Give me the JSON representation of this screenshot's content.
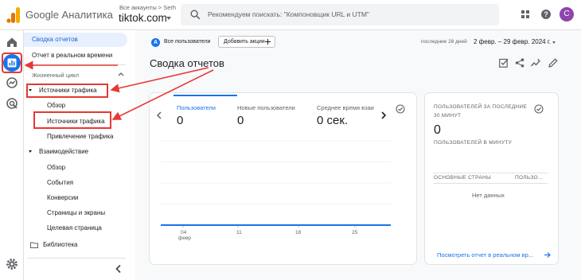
{
  "header": {
    "app_title": "Google Аналитика",
    "account_breadcrumb": "Все аккаунты > Serh",
    "account_name": "tiktok.com",
    "search_placeholder": "Рекомендуем поискать: \"Компоновщик URL и UTM\"",
    "avatar_letter": "C"
  },
  "nav": {
    "items": [
      {
        "label": "Сводка отчетов"
      },
      {
        "label": "Отчет в реальном времени"
      },
      {
        "label": "Жизненный цикл"
      },
      {
        "label": "Источники трафика"
      },
      {
        "label": "Обзор"
      },
      {
        "label": "Источники трафика"
      },
      {
        "label": "Привлечение трафика"
      },
      {
        "label": "Взаимодействие"
      },
      {
        "label": "Обзор"
      },
      {
        "label": "События"
      },
      {
        "label": "Конверсии"
      },
      {
        "label": "Страницы и экраны"
      },
      {
        "label": "Целевая страница"
      },
      {
        "label": "Библиотека"
      }
    ]
  },
  "toolbar": {
    "segment_initial": "A",
    "segment_label": "Все пользователи",
    "add_comparison": "Добавить акции",
    "date_label": "последние 28 дней",
    "date_range": "2 февр. – 29 февр. 2024 г."
  },
  "page": {
    "title": "Сводка отчетов"
  },
  "metrics": [
    {
      "label": "Пользователи",
      "value": "0",
      "active": true
    },
    {
      "label": "Новые пользователи",
      "value": "0"
    },
    {
      "label": "Среднее время взаи",
      "value": "0 сек."
    }
  ],
  "chart_data": {
    "type": "line",
    "x": [
      "04 февр",
      "11",
      "18",
      "25"
    ],
    "series": [
      {
        "values": [
          0,
          0,
          0,
          0
        ]
      }
    ],
    "ylim": [
      0,
      1
    ],
    "grid": true
  },
  "chart_labels": {
    "first_tick": "04",
    "first_tick_sub": "февр"
  },
  "realtime": {
    "title": "ПОЛЬЗОВАТЕЛЕЙ ЗА ПОСЛЕДНИЕ 30 МИНУТ",
    "value": "0",
    "subtitle": "ПОЛЬЗОВАТЕЛЕЙ В МИНУТУ",
    "col_country": "ОСНОВНЫЕ СТРАНЫ",
    "col_users": "ПОЛЬЗО...",
    "no_data": "Нет данных",
    "link": "Посмотреть отчет в реальном вр..."
  },
  "colors": {
    "accent": "#1a73e8",
    "annotation": "#e53935",
    "avatar": "#8e44ad"
  },
  "icons": [
    "ga-logo-icon",
    "search-icon",
    "apps-icon",
    "help-icon",
    "home-icon",
    "reports-icon",
    "explore-icon",
    "advertising-icon",
    "settings-icon",
    "folder-icon",
    "chevron-left-icon",
    "share-icon",
    "edit-icon",
    "insights-icon",
    "customize-icon"
  ]
}
